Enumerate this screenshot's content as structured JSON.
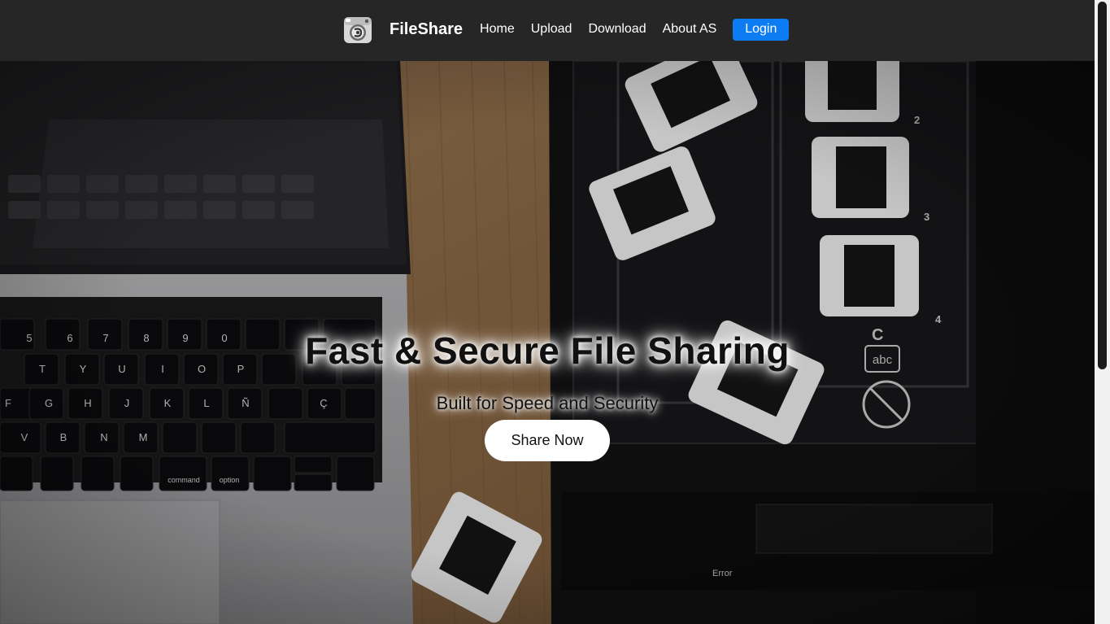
{
  "nav": {
    "brand": "FileShare",
    "links": [
      "Home",
      "Upload",
      "Download",
      "About AS"
    ],
    "login_label": "Login"
  },
  "hero": {
    "title": "Fast & Secure File Sharing",
    "subtitle": "Built for Speed and Security",
    "cta_label": "Share Now"
  },
  "colors": {
    "navbar_bg": "#262626",
    "login_bg": "#0d7cf2",
    "cta_bg": "#ffffff"
  },
  "icons": {
    "logo": "camera-app-icon"
  },
  "background_image": {
    "keyboard_keys_row1": [
      "%\n5",
      "&\n6",
      "/\n7",
      "(\n8",
      ")\n9",
      "=\n0",
      "?\n'"
    ],
    "keyboard_keys_row2": [
      "T",
      "Y",
      "U",
      "I",
      "O",
      "P"
    ],
    "keyboard_keys_row3": [
      "F",
      "G",
      "H",
      "J",
      "K",
      "L",
      "Ñ",
      "Ç"
    ],
    "keyboard_keys_row4": [
      "V",
      "B",
      "N",
      "M"
    ],
    "command_key": "command",
    "option_key": "option",
    "scanner_labels": [
      "2",
      "3",
      "4",
      "C",
      "abc",
      "Error"
    ]
  }
}
